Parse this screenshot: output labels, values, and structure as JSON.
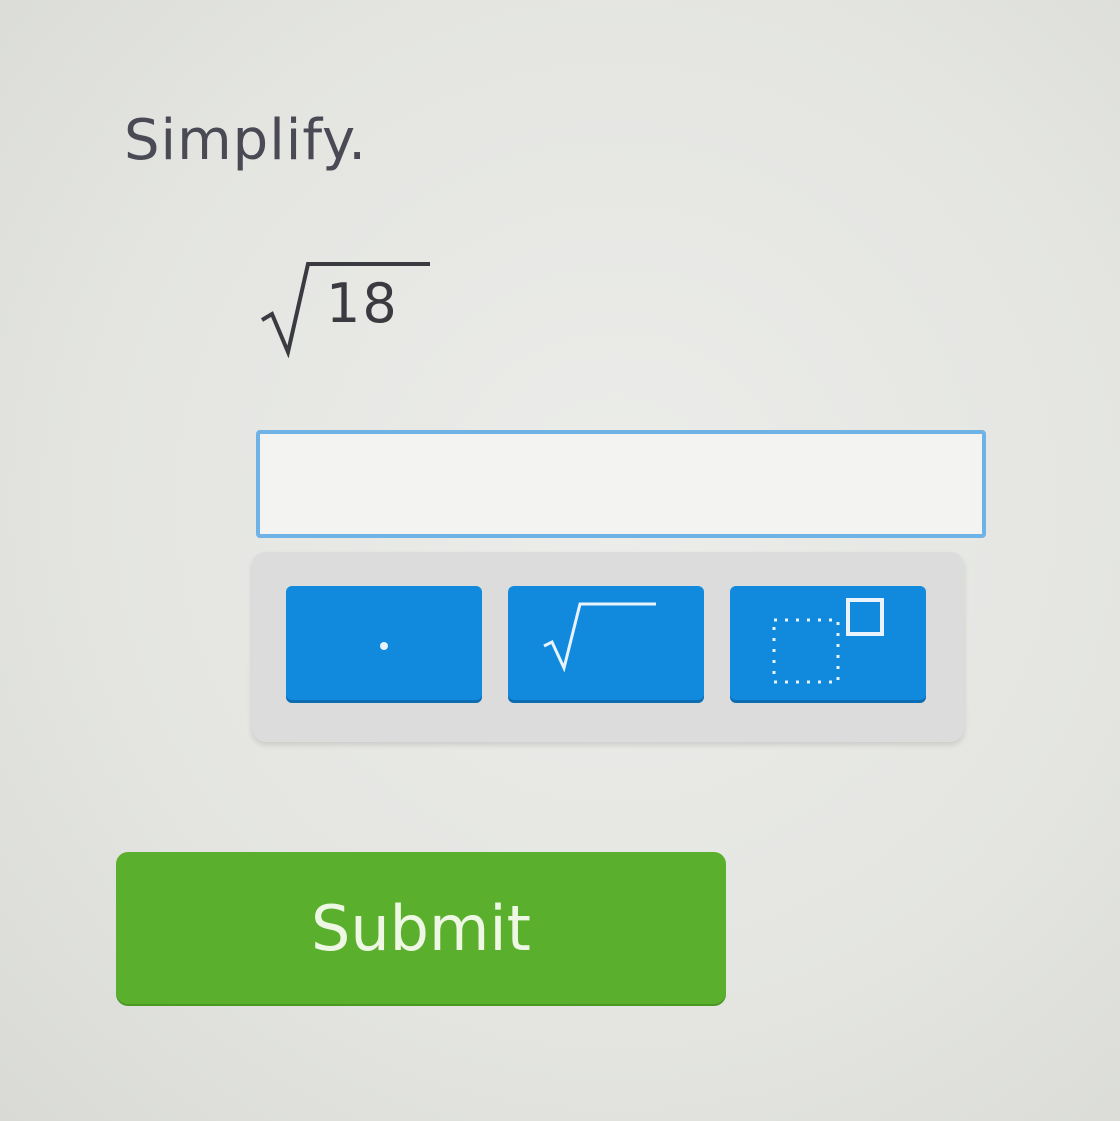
{
  "question": {
    "prompt": "Simplify.",
    "radicand": "18"
  },
  "answer": {
    "value": "",
    "placeholder": ""
  },
  "keypad": {
    "keys": [
      {
        "name": "decimal-point",
        "icon": "dot-icon"
      },
      {
        "name": "square-root",
        "icon": "sqrt-icon"
      },
      {
        "name": "exponent",
        "icon": "exponent-icon"
      }
    ]
  },
  "actions": {
    "submit_label": "Submit"
  },
  "colors": {
    "key_blue": "#1189dc",
    "input_border": "#6fb2e6",
    "submit_green": "#5ab02d"
  }
}
